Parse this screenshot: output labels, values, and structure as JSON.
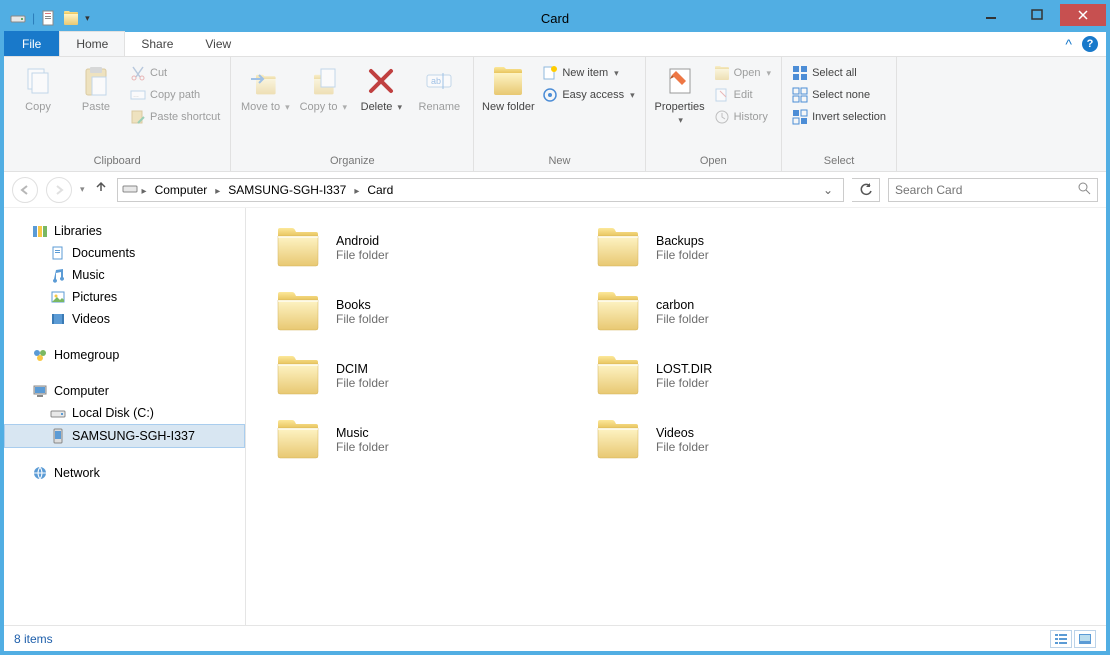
{
  "window": {
    "title": "Card"
  },
  "tabs": {
    "file": "File",
    "home": "Home",
    "share": "Share",
    "view": "View"
  },
  "ribbon": {
    "clipboard": {
      "label": "Clipboard",
      "copy": "Copy",
      "paste": "Paste",
      "cut": "Cut",
      "copy_path": "Copy path",
      "paste_shortcut": "Paste shortcut"
    },
    "organize": {
      "label": "Organize",
      "move_to": "Move to",
      "copy_to": "Copy to",
      "delete": "Delete",
      "rename": "Rename"
    },
    "new": {
      "label": "New",
      "new_folder": "New folder",
      "new_item": "New item",
      "easy_access": "Easy access"
    },
    "open": {
      "label": "Open",
      "properties": "Properties",
      "open": "Open",
      "edit": "Edit",
      "history": "History"
    },
    "select": {
      "label": "Select",
      "select_all": "Select all",
      "select_none": "Select none",
      "invert": "Invert selection"
    }
  },
  "breadcrumb": {
    "items": [
      "Computer",
      "SAMSUNG-SGH-I337",
      "Card"
    ]
  },
  "search": {
    "placeholder": "Search Card"
  },
  "tree": {
    "libraries": "Libraries",
    "documents": "Documents",
    "music": "Music",
    "pictures": "Pictures",
    "videos": "Videos",
    "homegroup": "Homegroup",
    "computer": "Computer",
    "local_disk": "Local Disk (C:)",
    "device": "SAMSUNG-SGH-I337",
    "network": "Network"
  },
  "items": [
    {
      "name": "Android",
      "type": "File folder"
    },
    {
      "name": "Backups",
      "type": "File folder"
    },
    {
      "name": "Books",
      "type": "File folder"
    },
    {
      "name": "carbon",
      "type": "File folder"
    },
    {
      "name": "DCIM",
      "type": "File folder"
    },
    {
      "name": "LOST.DIR",
      "type": "File folder"
    },
    {
      "name": "Music",
      "type": "File folder"
    },
    {
      "name": "Videos",
      "type": "File folder"
    }
  ],
  "status": {
    "count": "8 items"
  }
}
